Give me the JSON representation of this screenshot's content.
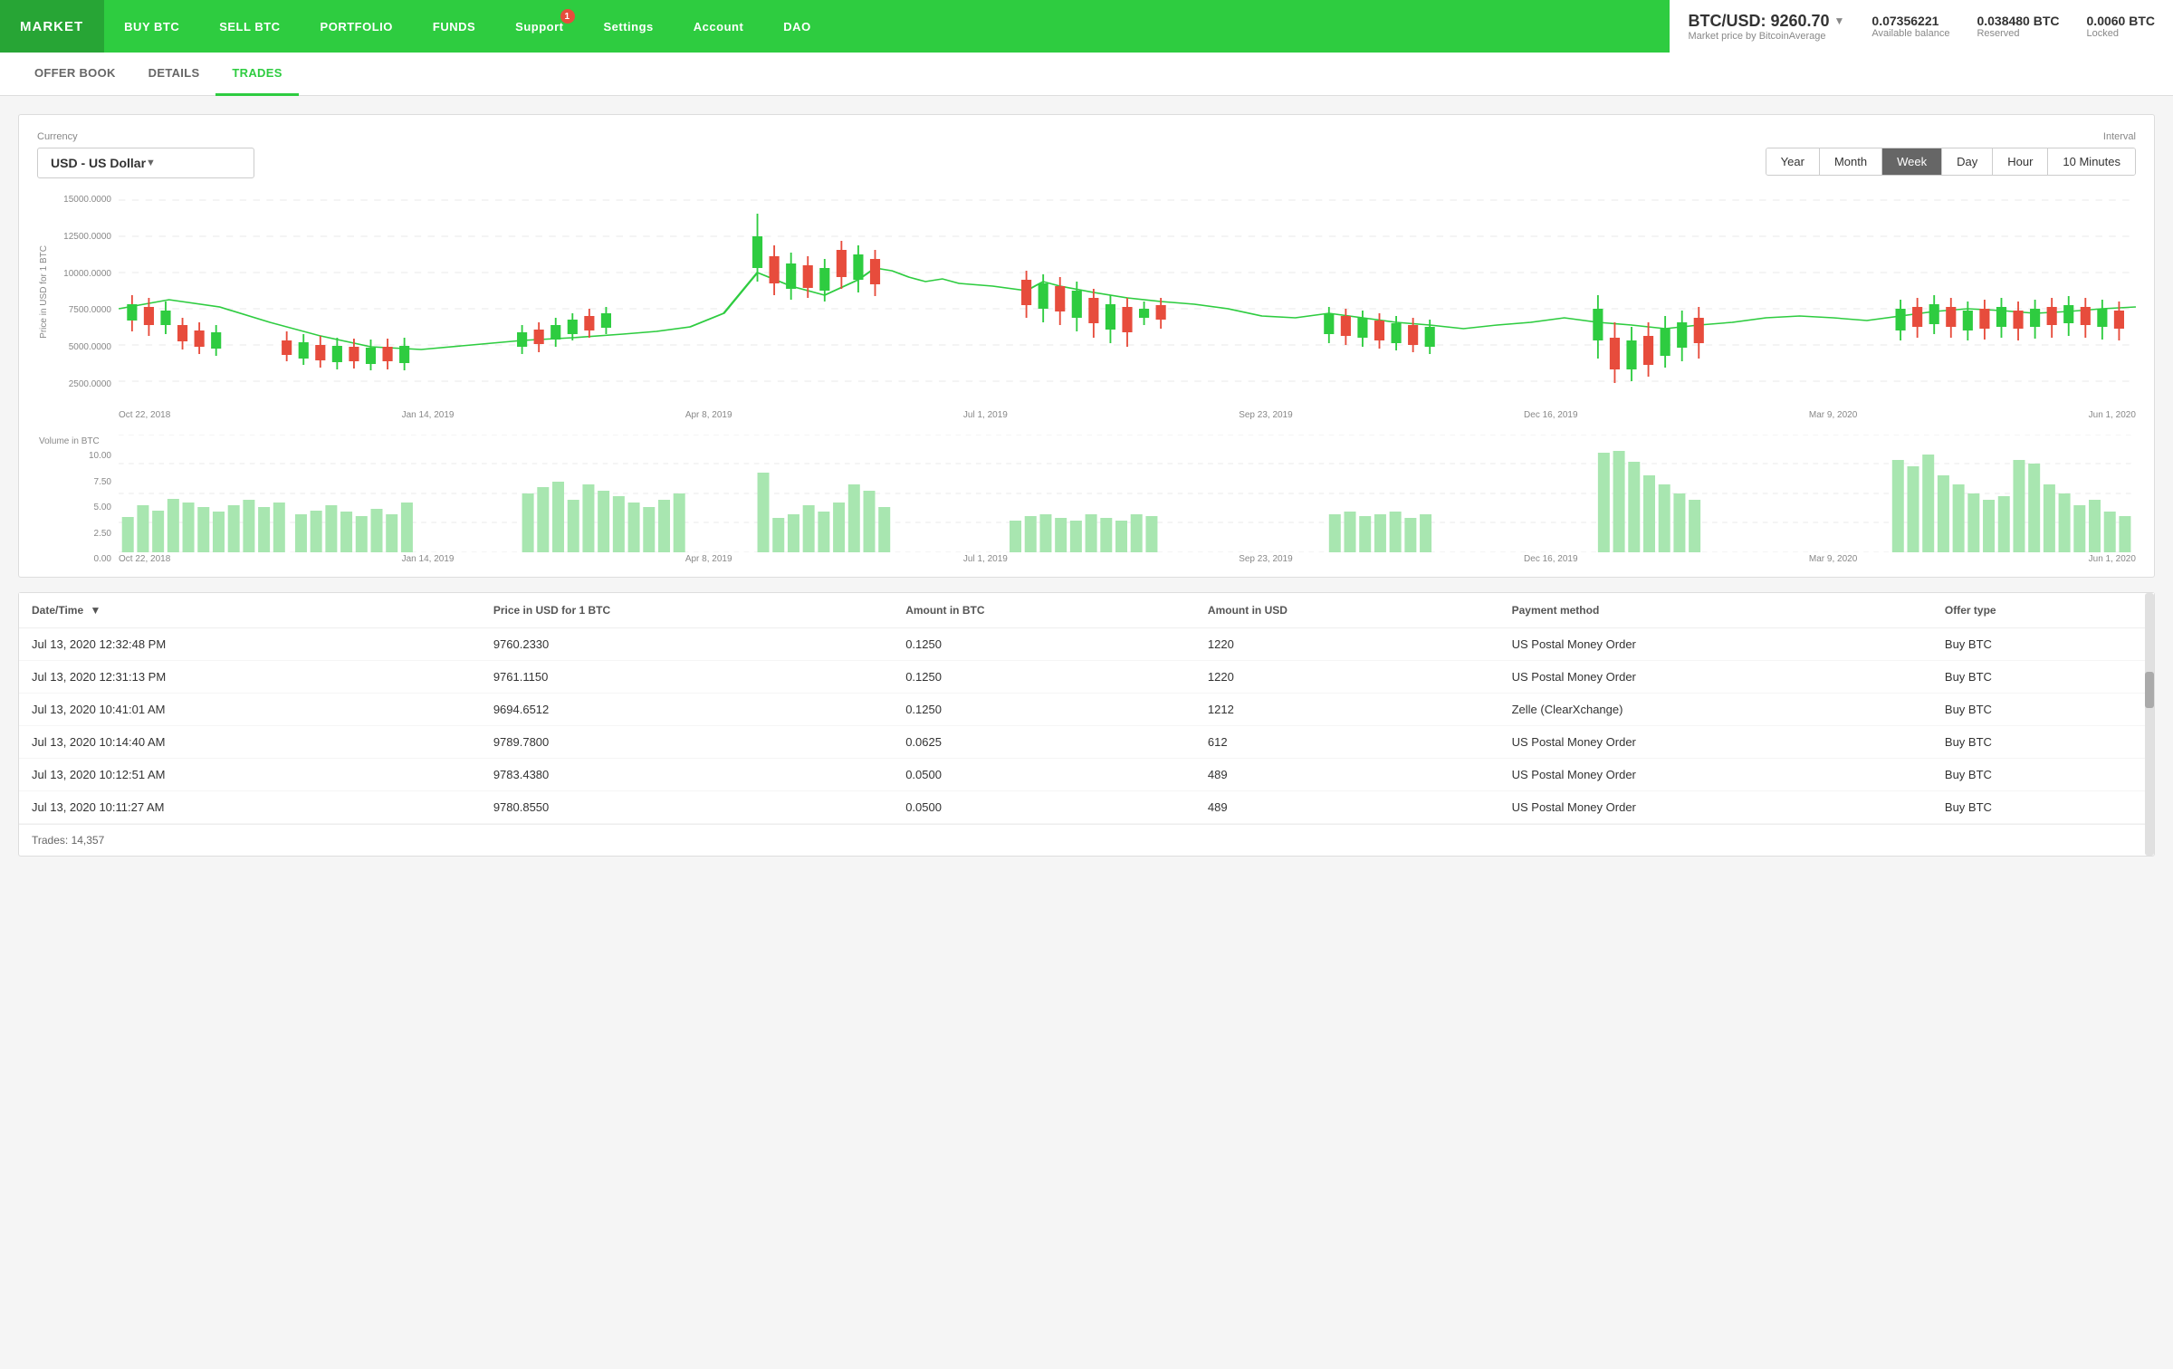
{
  "nav": {
    "brand": "MARKET",
    "links": [
      {
        "label": "BUY BTC",
        "badge": null
      },
      {
        "label": "SELL BTC",
        "badge": null
      },
      {
        "label": "PORTFOLIO",
        "badge": null
      },
      {
        "label": "FUNDS",
        "badge": null
      },
      {
        "label": "Support",
        "badge": "1"
      },
      {
        "label": "Settings",
        "badge": null
      },
      {
        "label": "Account",
        "badge": null
      },
      {
        "label": "DAO",
        "badge": null
      }
    ],
    "price_label": "BTC/USD: 9260.70",
    "price_sub": "Market price by BitcoinAverage",
    "available_balance": "0.07356221",
    "available_label": "Available balance",
    "reserved": "0.038480 BTC",
    "reserved_label": "Reserved",
    "locked": "0.0060 BTC",
    "locked_label": "Locked"
  },
  "tabs": [
    {
      "label": "OFFER BOOK",
      "active": false
    },
    {
      "label": "DETAILS",
      "active": false
    },
    {
      "label": "TRADES",
      "active": true
    }
  ],
  "currency": {
    "label": "Currency",
    "value": "USD  -  US Dollar"
  },
  "interval": {
    "label": "Interval",
    "options": [
      "Year",
      "Month",
      "Week",
      "Day",
      "Hour",
      "10 Minutes"
    ],
    "active": "Week"
  },
  "chart": {
    "y_labels": [
      "15000.0000",
      "12500.0000",
      "10000.0000",
      "7500.0000",
      "5000.0000",
      "2500.0000"
    ],
    "x_labels": [
      "Oct 22, 2018",
      "Jan 14, 2019",
      "Apr 8, 2019",
      "Jul 1, 2019",
      "Sep 23, 2019",
      "Dec 16, 2019",
      "Mar 9, 2020",
      "Jun 1, 2020"
    ],
    "y_axis_title": "Price in USD for 1 BTC"
  },
  "volume_chart": {
    "y_labels": [
      "10.00",
      "7.50",
      "5.00",
      "2.50",
      "0.00"
    ],
    "x_labels": [
      "Oct 22, 2018",
      "Jan 14, 2019",
      "Apr 8, 2019",
      "Jul 1, 2019",
      "Sep 23, 2019",
      "Dec 16, 2019",
      "Mar 9, 2020",
      "Jun 1, 2020"
    ],
    "title": "Volume in BTC"
  },
  "table": {
    "headers": [
      "Date/Time",
      "Price in USD for 1 BTC",
      "Amount in BTC",
      "Amount in USD",
      "Payment method",
      "Offer type"
    ],
    "rows": [
      {
        "datetime": "Jul 13, 2020 12:32:48 PM",
        "price": "9760.2330",
        "amount_btc": "0.1250",
        "amount_usd": "1220",
        "payment": "US Postal Money Order",
        "offer_type": "Buy BTC"
      },
      {
        "datetime": "Jul 13, 2020 12:31:13 PM",
        "price": "9761.1150",
        "amount_btc": "0.1250",
        "amount_usd": "1220",
        "payment": "US Postal Money Order",
        "offer_type": "Buy BTC"
      },
      {
        "datetime": "Jul 13, 2020 10:41:01 AM",
        "price": "9694.6512",
        "amount_btc": "0.1250",
        "amount_usd": "1212",
        "payment": "Zelle (ClearXchange)",
        "offer_type": "Buy BTC"
      },
      {
        "datetime": "Jul 13, 2020 10:14:40 AM",
        "price": "9789.7800",
        "amount_btc": "0.0625",
        "amount_usd": "612",
        "payment": "US Postal Money Order",
        "offer_type": "Buy BTC"
      },
      {
        "datetime": "Jul 13, 2020 10:12:51 AM",
        "price": "9783.4380",
        "amount_btc": "0.0500",
        "amount_usd": "489",
        "payment": "US Postal Money Order",
        "offer_type": "Buy BTC"
      },
      {
        "datetime": "Jul 13, 2020 10:11:27 AM",
        "price": "9780.8550",
        "amount_btc": "0.0500",
        "amount_usd": "489",
        "payment": "US Postal Money Order",
        "offer_type": "Buy BTC"
      }
    ],
    "footer": "Trades: 14,357"
  }
}
